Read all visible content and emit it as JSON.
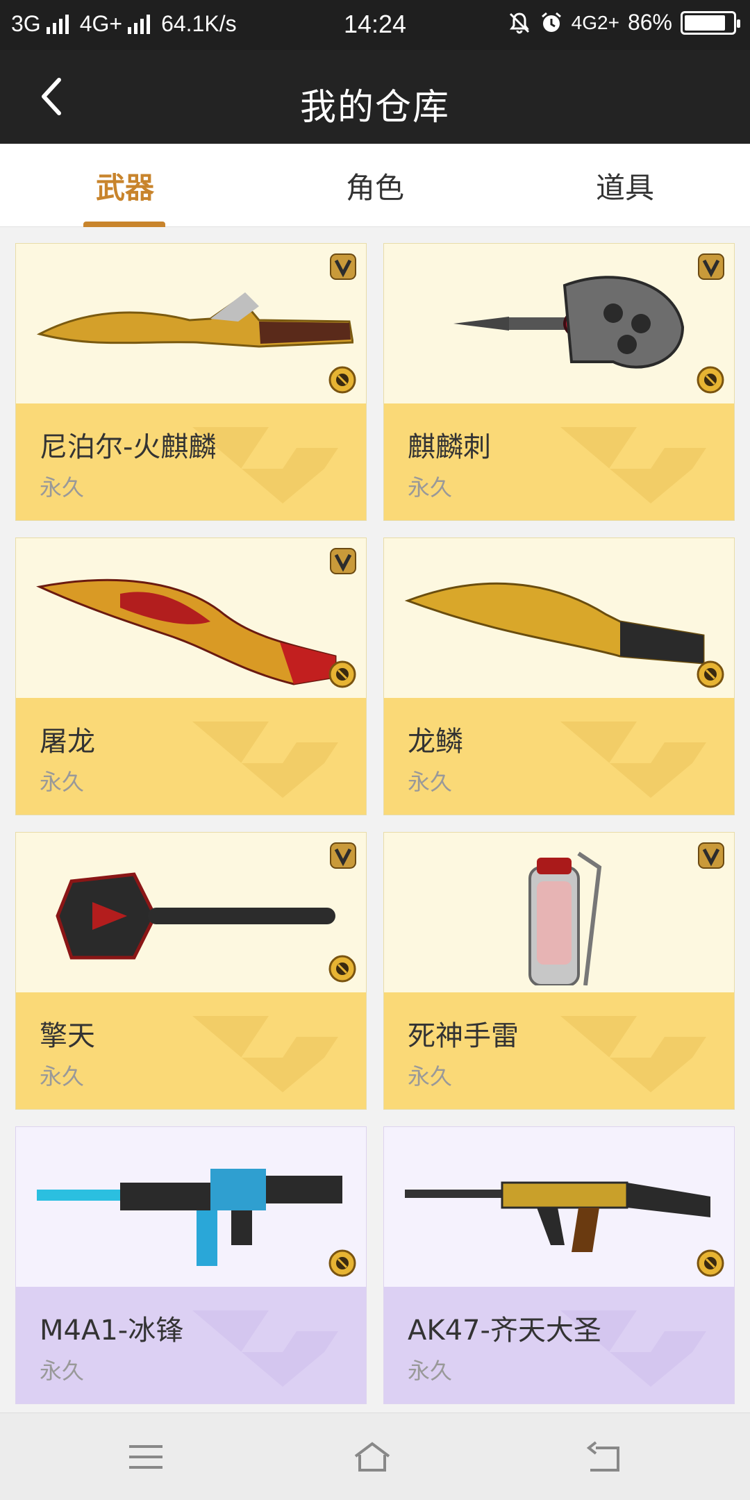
{
  "status_bar": {
    "network_left": "3G",
    "network_right": "4G+",
    "speed": "64.1K/s",
    "time": "14:24",
    "network_extra": "4G2+",
    "battery": "86%",
    "battery_level": 0.86
  },
  "header": {
    "title": "我的仓库",
    "back_icon": "chevron-left-icon"
  },
  "tabs": [
    {
      "label": "武器",
      "active": true
    },
    {
      "label": "角色",
      "active": false
    },
    {
      "label": "道具",
      "active": false
    }
  ],
  "items": [
    {
      "name": "尼泊尔-火麒麟",
      "duration": "永久",
      "theme": "gold",
      "v_badge": true,
      "weapon": "knife-gold"
    },
    {
      "name": "麒麟刺",
      "duration": "永久",
      "theme": "gold",
      "v_badge": true,
      "weapon": "knuckle"
    },
    {
      "name": "屠龙",
      "duration": "永久",
      "theme": "gold",
      "v_badge": true,
      "weapon": "knife-red"
    },
    {
      "name": "龙鳞",
      "duration": "永久",
      "theme": "gold",
      "v_badge": false,
      "weapon": "knife-plain"
    },
    {
      "name": "擎天",
      "duration": "永久",
      "theme": "gold",
      "v_badge": true,
      "weapon": "shovel"
    },
    {
      "name": "死神手雷",
      "duration": "永久",
      "theme": "gold",
      "v_badge": true,
      "weapon": "grenade"
    },
    {
      "name": "M4A1-冰锋",
      "duration": "永久",
      "theme": "purple",
      "v_badge": false,
      "weapon": "rifle-ice"
    },
    {
      "name": "AK47-齐天大圣",
      "duration": "永久",
      "theme": "purple",
      "v_badge": false,
      "weapon": "rifle-gold"
    }
  ],
  "colors": {
    "accent": "#c8842c",
    "gold_card": "#fad977",
    "purple_card": "#dcd0f3"
  },
  "nav": {
    "menu_icon": "menu-icon",
    "home_icon": "home-icon",
    "back_icon": "back-arrow-icon"
  }
}
